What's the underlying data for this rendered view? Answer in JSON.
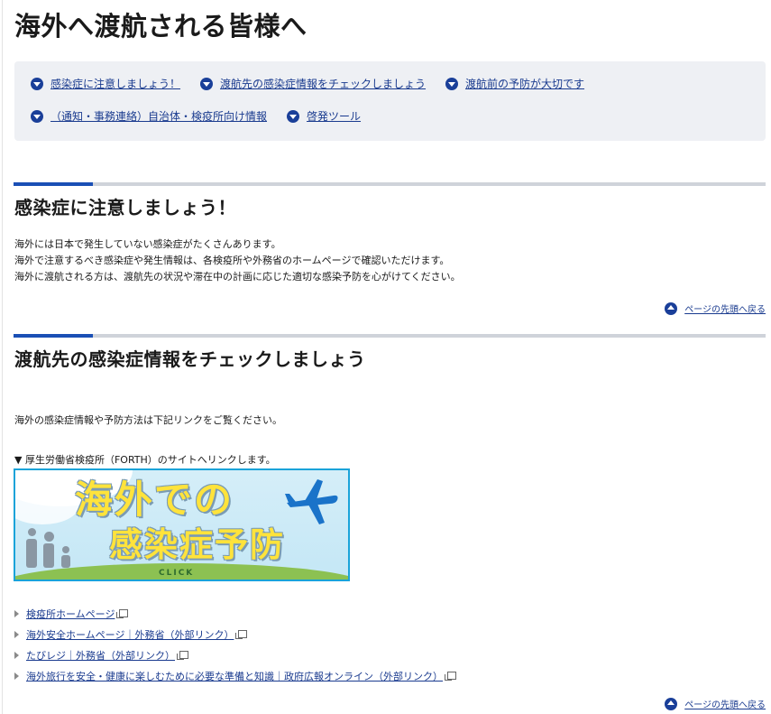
{
  "page": {
    "title": "海外へ渡航される皆様へ"
  },
  "anchors": [
    {
      "label": "感染症に注意しましょう！"
    },
    {
      "label": "渡航先の感染症情報をチェックしましょう"
    },
    {
      "label": "渡航前の予防が大切です"
    },
    {
      "label": "（通知・事務連絡）自治体・検疫所向け情報"
    },
    {
      "label": "啓発ツール"
    }
  ],
  "section1": {
    "title": "感染症に注意しましょう！",
    "lines": [
      "海外には日本で発生していない感染症がたくさんあります。",
      "海外で注意するべき感染症や発生情報は、各検疫所や外務省のホームページで確認いただけます。",
      "海外に渡航される方は、渡航先の状況や滞在中の計画に応じた適切な感染予防を心がけてください。"
    ]
  },
  "back_to_top": "ページの先頭へ戻る",
  "section2": {
    "title": "渡航先の感染症情報をチェックしましょう",
    "intro": "海外の感染症情報や予防方法は下記リンクをご覧ください。",
    "note": "▼ 厚生労働省検疫所（FORTH）のサイトへリンクします。",
    "banner": {
      "line1": "海外での",
      "line2": "感染症予防",
      "click": "CLICK"
    },
    "links": [
      {
        "label": "検疫所ホームページ"
      },
      {
        "label": "海外安全ホームページ｜外務省（外部リンク）"
      },
      {
        "label": "たびレジ｜外務省（外部リンク）"
      },
      {
        "label": "海外旅行を安全・健康に楽しむために必要な準備と知識｜政府広報オンライン（外部リンク）"
      }
    ]
  },
  "colors": {
    "accent": "#1a4fb5",
    "link": "#1a3b8f",
    "anchor_box_bg": "#eef0f4",
    "banner_border": "#1aa3d9",
    "banner_text": "#ffe33b"
  },
  "icons": {
    "anchor": "chevron-down-circle-icon",
    "back_to_top": "chevron-up-circle-icon",
    "link_bullet": "triangle-right-icon",
    "external": "external-window-icon",
    "banner_plane": "airplane-icon"
  }
}
